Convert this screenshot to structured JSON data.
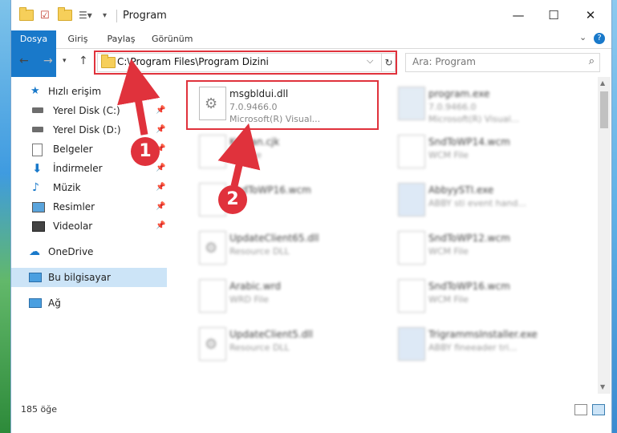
{
  "window": {
    "title": "Program"
  },
  "ribbon": {
    "tabs": [
      "Dosya",
      "Giriş",
      "Paylaş",
      "Görünüm"
    ]
  },
  "address": {
    "path": "C:\\Program Files\\Program Dizini"
  },
  "search": {
    "placeholder": "Ara: Program"
  },
  "nav": {
    "items": [
      {
        "label": "Hızlı erişim",
        "icon": "star-icon",
        "pinned": false
      },
      {
        "label": "Yerel Disk (C:)",
        "icon": "disk-icon",
        "pinned": true
      },
      {
        "label": "Yerel Disk (D:)",
        "icon": "disk-icon",
        "pinned": true
      },
      {
        "label": "Belgeler",
        "icon": "documents-icon",
        "pinned": true
      },
      {
        "label": "İndirmeler",
        "icon": "download-icon",
        "pinned": true
      },
      {
        "label": "Müzik",
        "icon": "music-icon",
        "pinned": true
      },
      {
        "label": "Resimler",
        "icon": "pictures-icon",
        "pinned": true
      },
      {
        "label": "Videolar",
        "icon": "videos-icon",
        "pinned": true
      },
      {
        "label": "OneDrive",
        "icon": "onedrive-icon",
        "pinned": false
      },
      {
        "label": "Bu bilgisayar",
        "icon": "computer-icon",
        "pinned": false,
        "selected": true
      },
      {
        "label": "Ağ",
        "icon": "network-icon",
        "pinned": false
      }
    ]
  },
  "files": [
    {
      "name": "msgbldui.dll",
      "line2": "7.0.9466.0",
      "line3": "Microsoft(R) Visual...",
      "highlight": true
    },
    {
      "name": "program.exe",
      "line2": "7.0.9466.0",
      "line3": "Microsoft(R) Visual..."
    },
    {
      "name": "Korean.cjk",
      "line2": "CJK File",
      "line3": ""
    },
    {
      "name": "SndToWP14.wcm",
      "line2": "WCM File",
      "line3": ""
    },
    {
      "name": "SndToWP16.wcm",
      "line2": "",
      "line3": ""
    },
    {
      "name": "AbbyySTI.exe",
      "line2": "ABBY sti event hand...",
      "line3": ""
    },
    {
      "name": "UpdateClient65.dll",
      "line2": "Resource DLL",
      "line3": ""
    },
    {
      "name": "SndToWP12.wcm",
      "line2": "WCM File",
      "line3": ""
    },
    {
      "name": "Arabic.wrd",
      "line2": "WRD File",
      "line3": ""
    },
    {
      "name": "SndToWP16.wcm",
      "line2": "WCM File",
      "line3": ""
    },
    {
      "name": "UpdateClient5.dll",
      "line2": "Resource DLL",
      "line3": ""
    },
    {
      "name": "TrigrammsInstaller.exe",
      "line2": "ABBY fineeader tri...",
      "line3": ""
    }
  ],
  "status": {
    "count": "185 öğe"
  },
  "annotations": {
    "badge1": "1",
    "badge2": "2",
    "color": "#e0323c"
  }
}
